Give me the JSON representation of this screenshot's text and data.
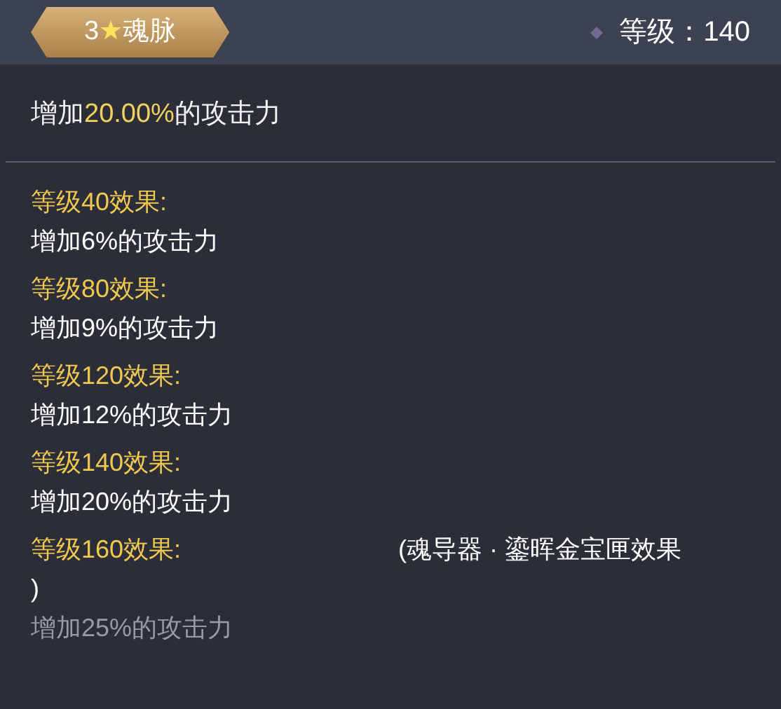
{
  "header": {
    "badge": {
      "rank": "3",
      "star": "★",
      "name": "魂脉"
    },
    "level_text": "等级：140"
  },
  "summary": "增加**20.00%**的攻击力",
  "effects": [
    {
      "title": "等级40效果:",
      "description": "增加6%的攻击力",
      "unlocked": true
    },
    {
      "title": "等级80效果:",
      "description": "增加9%的攻击力",
      "unlocked": true
    },
    {
      "title": "等级120效果:",
      "description": "增加12%的攻击力",
      "unlocked": true
    },
    {
      "title": "等级140效果:",
      "description": "增加20%的攻击力",
      "unlocked": true
    },
    {
      "title": "等级160效果:",
      "note": "(魂导器 · 鎏晖金宝匣效果",
      "note_end": ")",
      "description": "增加25%的攻击力",
      "unlocked": false
    }
  ]
}
